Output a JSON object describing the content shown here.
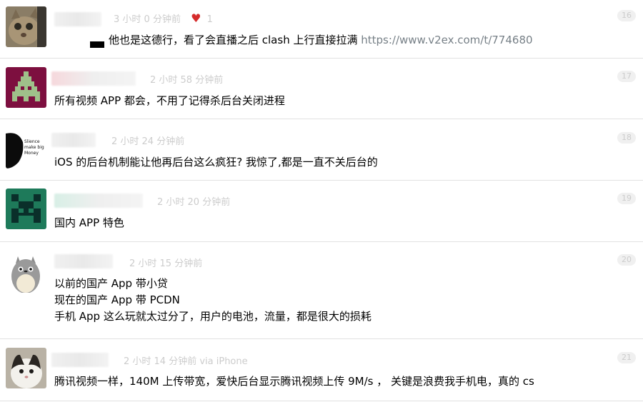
{
  "replies": [
    {
      "ago": "3 小时 0 分钟前",
      "heart_count": "1",
      "floor": "16",
      "text": "他也是这德行，看了会直播之后 clash 上行直接拉满",
      "link": "https://www.v2ex.com/t/774680",
      "avatar_icon": "cat-photo-avatar"
    },
    {
      "ago": "2 小时 58 分钟前",
      "floor": "17",
      "text": "所有视频 APP 都会，不用了记得杀后台关闭进程",
      "avatar_icon": "pixel-invader-avatar"
    },
    {
      "ago": "2 小时 24 分钟前",
      "floor": "18",
      "text": "iOS 的后台机制能让他再后台这么疯狂? 我惊了,都是一直不关后台的",
      "avatar_icon": "silence-money-avatar",
      "avatar_text": [
        "Slience",
        "make big",
        "Money"
      ]
    },
    {
      "ago": "2 小时 20 分钟前",
      "floor": "19",
      "text": "国内 APP 特色",
      "avatar_icon": "pixel-green-avatar"
    },
    {
      "ago": "2 小时 15 分钟前",
      "floor": "20",
      "lines": [
        "以前的国产 App 带小贷",
        "现在的国产 App 带 PCDN",
        "手机 App 这么玩就太过分了，用户的电池，流量，都是很大的损耗"
      ],
      "avatar_icon": "totoro-avatar"
    },
    {
      "ago": "2 小时 14 分钟前 via iPhone",
      "floor": "21",
      "text": "腾讯视频一样，140M 上传带宽，爱快后台显示腾讯视频上传 9M/s ， 关键是浪费我手机电，真的 cs",
      "avatar_icon": "cat-face-avatar"
    }
  ]
}
